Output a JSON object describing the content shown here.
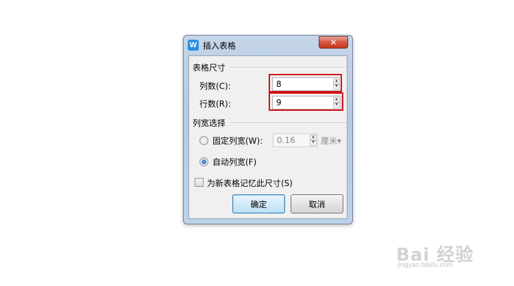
{
  "dialog": {
    "title": "插入表格",
    "app_icon_letter": "W",
    "close_glyph": "✕"
  },
  "size_group": {
    "title": "表格尺寸",
    "columns_label": "列数(C):",
    "columns_value": "8",
    "rows_label": "行数(R):",
    "rows_value": "9"
  },
  "width_group": {
    "title": "列宽选择",
    "fixed_label": "固定列宽(W):",
    "fixed_value": "0.16",
    "fixed_unit": "厘米",
    "fixed_unit_arrow": "▾",
    "auto_label": "自动列宽(F)",
    "selected": "auto"
  },
  "remember": {
    "label": "为新表格记忆此尺寸(S)",
    "checked": false
  },
  "buttons": {
    "ok": "确定",
    "cancel": "取消"
  },
  "spin_glyphs": {
    "up": "▲",
    "down": "▼"
  },
  "highlight_color": "#d60f14",
  "watermark": {
    "brand": "Bai 经验",
    "url": "jingyan.baidu.com"
  }
}
